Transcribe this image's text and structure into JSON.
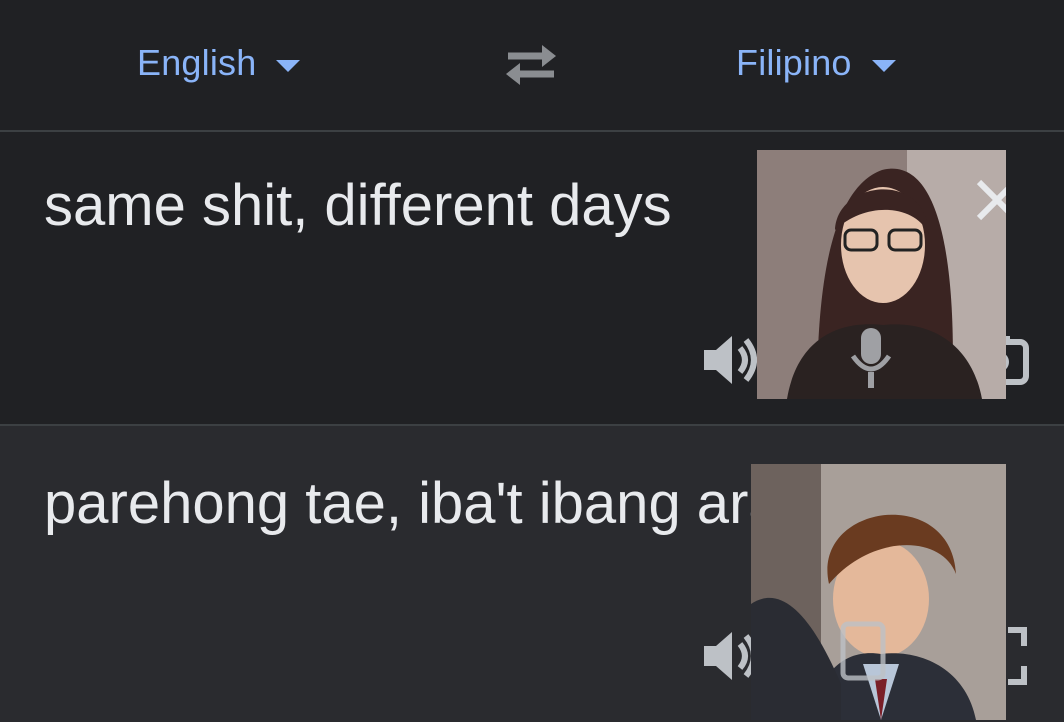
{
  "header": {
    "source_language": "English",
    "target_language": "Filipino",
    "swap_icon": "swap-arrows-icon"
  },
  "source": {
    "text": "same shit, different days",
    "icons": [
      "close-icon",
      "speaker-icon",
      "microphone-icon",
      "camera-icon"
    ]
  },
  "target": {
    "text": "parehong tae, iba't ibang araw",
    "icons": [
      "speaker-icon",
      "copy-icon",
      "fullscreen-icon"
    ]
  },
  "colors": {
    "accent": "#8ab4f8",
    "text": "#e8eaed",
    "icon": "#bdc1c6",
    "background": "#202124",
    "output_background": "#2a2b2f"
  }
}
